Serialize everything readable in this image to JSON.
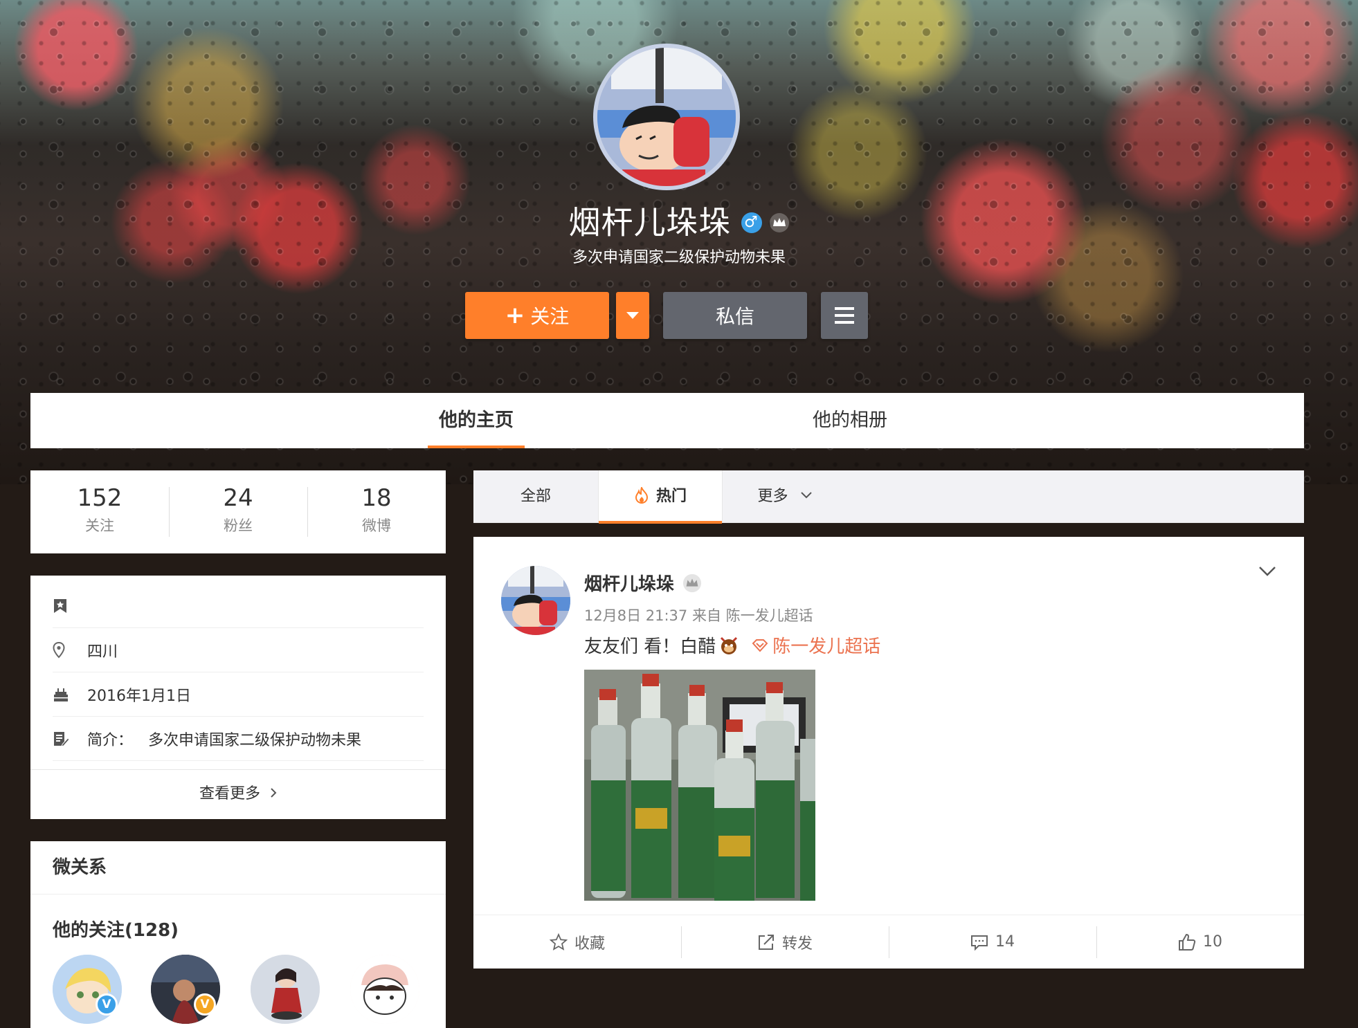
{
  "profile": {
    "nickname": "烟杆儿垛垛",
    "bio": "多次申请国家二级保护动物未果",
    "gender_icon": "male-icon",
    "badge_icon": "crown-icon",
    "follow_label": "关注",
    "message_label": "私信"
  },
  "main_tabs": [
    {
      "label": "他的主页",
      "active": true
    },
    {
      "label": "他的相册",
      "active": false
    }
  ],
  "stats": [
    {
      "value": "152",
      "label": "关注"
    },
    {
      "value": "24",
      "label": "粉丝"
    },
    {
      "value": "18",
      "label": "微博"
    }
  ],
  "info": {
    "location": "四川",
    "birthday": "2016年1月1日",
    "intro_label": "简介：",
    "intro": "多次申请国家二级保护动物未果",
    "see_more": "查看更多"
  },
  "relations": {
    "title": "微关系",
    "following_label": "他的关注(128)"
  },
  "feed_tabs": [
    {
      "label": "全部",
      "active": false
    },
    {
      "label": "热门",
      "active": true
    },
    {
      "label": "更多",
      "active": false
    }
  ],
  "post": {
    "author": "烟杆儿垛垛",
    "meta": "12月8日 21:37 来自 陈一发儿超话",
    "text": "友友们 看！白醋",
    "topic": "陈一发儿超话",
    "actions": {
      "favorite": "收藏",
      "repost": "转发",
      "comments": "14",
      "likes": "10"
    }
  },
  "colors": {
    "accent": "#ff7f2a",
    "topic": "#eb7350",
    "button_dark": "#63666e",
    "verified_blue": "#3aa0e8",
    "verified_gold": "#f5a623"
  }
}
